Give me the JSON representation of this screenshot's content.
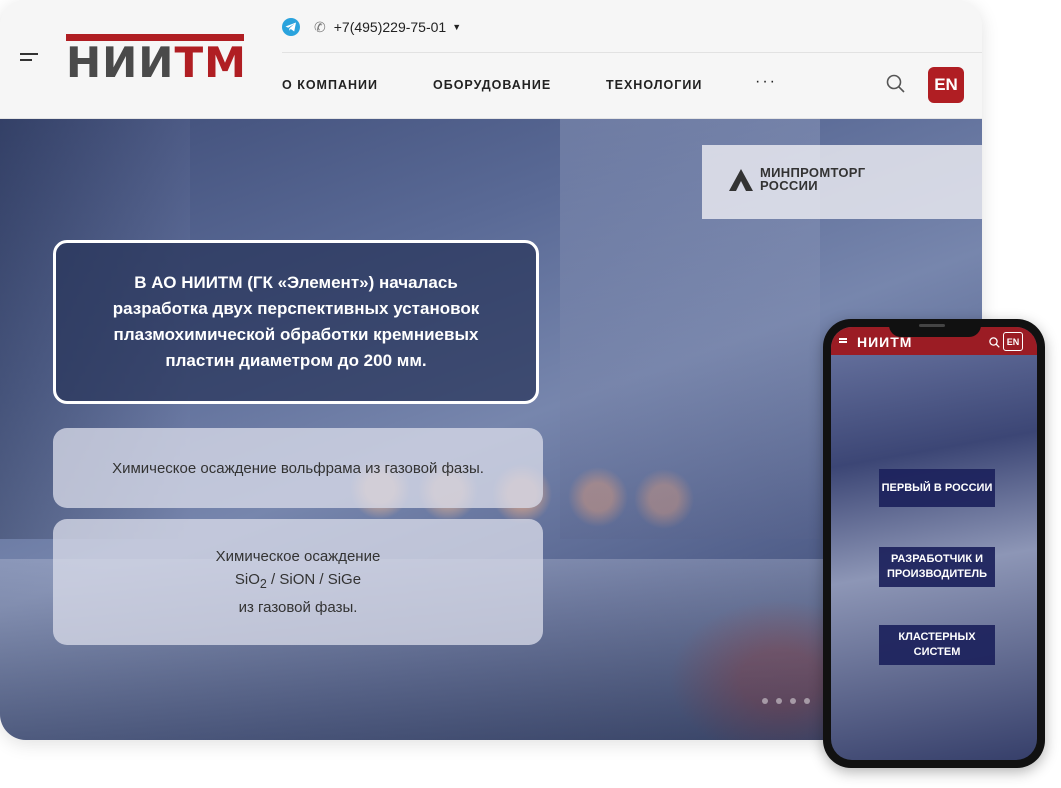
{
  "header": {
    "logo_part1": "НИИ",
    "logo_part2": "ТМ",
    "phone": "+7(495)229-75-01",
    "nav": [
      "О КОМПАНИИ",
      "ОБОРУДОВАНИЕ",
      "ТЕХНОЛОГИИ"
    ],
    "more": "···",
    "lang": "EN"
  },
  "partner": {
    "line1": "МИНПРОМТОРГ",
    "line2": "РОССИИ"
  },
  "hero": {
    "main_card": "В АО НИИТМ (ГК «Элемент») началась разработка двух перспективных установок плазмохимической обработки кремниевых пластин диаметром до 200 мм.",
    "card1": "Химическое осаждение вольфрама из газовой фазы.",
    "card2_line1": "Химическое осаждение",
    "card2_sio": "SiO",
    "card2_sub": "2",
    "card2_rest": " / SiON / SiGe",
    "card2_line3": "из газовой фазы."
  },
  "mobile": {
    "logo": "НИИТМ",
    "lang": "EN",
    "badges": [
      "ПЕРВЫЙ В РОССИИ",
      "РАЗРАБОТЧИК И ПРОИЗВОДИТЕЛЬ",
      "КЛАСТЕРНЫХ СИСТЕМ"
    ]
  },
  "colors": {
    "brand_red": "#b01e23",
    "telegram": "#2aa3dd",
    "badge_navy": "#1c225c"
  },
  "icons": [
    "menu-icon",
    "telegram-icon",
    "phone-icon",
    "chevron-down-icon",
    "search-icon",
    "minpromtorg-logo-icon"
  ]
}
